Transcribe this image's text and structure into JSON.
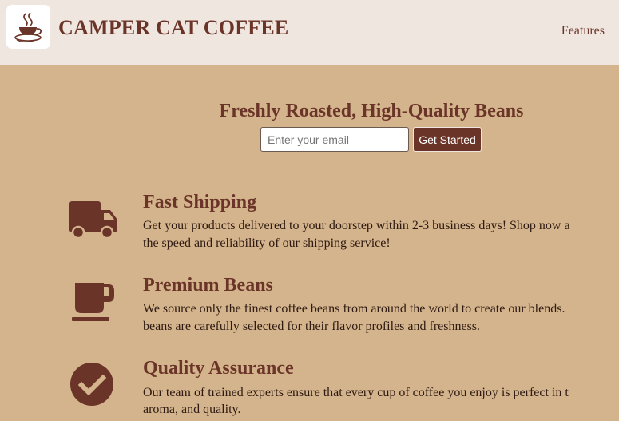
{
  "header": {
    "logo_icon": "coffee-cup-icon",
    "brand": "CAMPER CAT COFFEE",
    "nav_link": "Features"
  },
  "hero": {
    "title": "Freshly Roasted, High-Quality Beans",
    "email_placeholder": "Enter your email",
    "cta_label": "Get Started"
  },
  "features": [
    {
      "icon": "truck-icon",
      "title": "Fast Shipping",
      "line1": "Get your products delivered to your doorstep within 2-3 business days! Shop now a",
      "line2": "the speed and reliability of our shipping service!"
    },
    {
      "icon": "mug-icon",
      "title": "Premium Beans",
      "line1": "We source only the finest coffee beans from around the world to create our blends.",
      "line2": "beans are carefully selected for their flavor profiles and freshness."
    },
    {
      "icon": "check-circle-icon",
      "title": "Quality Assurance",
      "line1": "Our team of trained experts ensure that every cup of coffee you enjoy is perfect in t",
      "line2": "aroma, and quality."
    }
  ],
  "colors": {
    "page_background": "#d4b48c",
    "header_background": "#f0e6e0",
    "accent": "#6b3428"
  }
}
